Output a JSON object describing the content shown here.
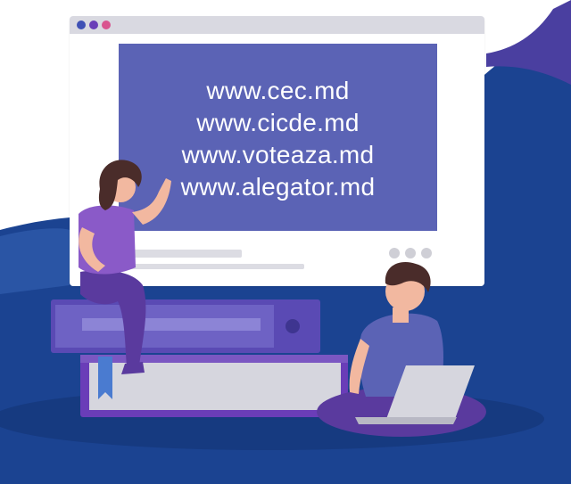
{
  "screen": {
    "urls": [
      "www.cec.md",
      "www.cicde.md",
      "www.voteaza.md",
      "www.alegator.md"
    ]
  },
  "colors": {
    "background_blue": "#1b4391",
    "screen_purple": "#5b63b5",
    "accent_purple": "#7b57c2",
    "window_chrome": "#d9d9e1"
  },
  "illustration": {
    "people": [
      "woman-waving",
      "man-with-laptop"
    ],
    "objects": [
      "browser-window",
      "stack-of-books",
      "laptop"
    ]
  }
}
